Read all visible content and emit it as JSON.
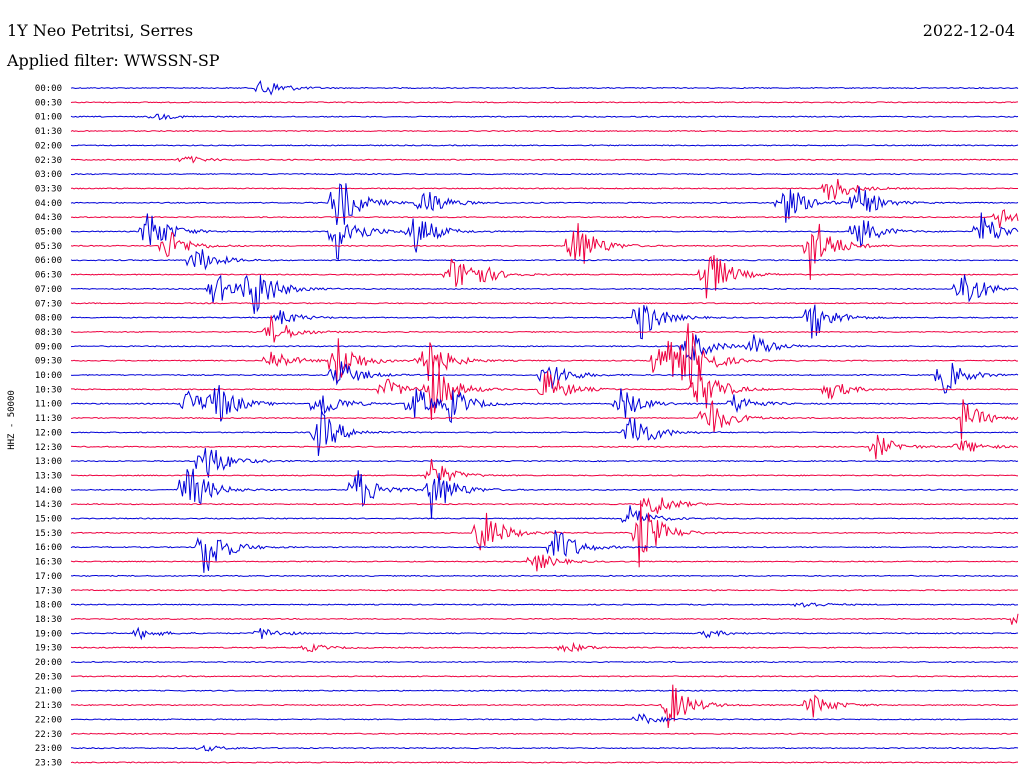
{
  "header": {
    "station": "1Y Neo Petritsi, Serres",
    "date": "2022-12-04",
    "filter": "Applied filter: WWSSN-SP"
  },
  "chart_data": {
    "type": "line",
    "ylabel": "HHZ - 50000",
    "colors": [
      "#0000d8",
      "#ee0040"
    ],
    "rows": [
      "00:00",
      "00:30",
      "01:00",
      "01:30",
      "02:00",
      "02:30",
      "03:00",
      "03:30",
      "04:00",
      "04:30",
      "05:00",
      "05:30",
      "06:00",
      "06:30",
      "07:00",
      "07:30",
      "08:00",
      "08:30",
      "09:00",
      "09:30",
      "10:00",
      "10:30",
      "11:00",
      "11:30",
      "12:00",
      "12:30",
      "13:00",
      "13:30",
      "14:00",
      "14:30",
      "15:00",
      "15:30",
      "16:00",
      "16:30",
      "17:00",
      "17:30",
      "18:00",
      "18:30",
      "19:00",
      "19:30",
      "20:00",
      "20:30",
      "21:00",
      "21:30",
      "22:00",
      "22:30",
      "23:00",
      "23:30"
    ],
    "events": [
      [
        0,
        0.2,
        0.6
      ],
      [
        2,
        0.09,
        0.15
      ],
      [
        5,
        0.12,
        0.2
      ],
      [
        8,
        0.28,
        1.6
      ],
      [
        8,
        0.37,
        0.9
      ],
      [
        8,
        0.75,
        1.2
      ],
      [
        8,
        0.83,
        0.9
      ],
      [
        7,
        0.8,
        0.8
      ],
      [
        9,
        0.98,
        0.5
      ],
      [
        10,
        0.08,
        1.3
      ],
      [
        10,
        0.28,
        1.5
      ],
      [
        10,
        0.36,
        1.2
      ],
      [
        10,
        0.83,
        0.9
      ],
      [
        10,
        0.96,
        1.0
      ],
      [
        11,
        0.1,
        0.9
      ],
      [
        11,
        0.53,
        1.6
      ],
      [
        11,
        0.78,
        1.8
      ],
      [
        12,
        0.13,
        0.8
      ],
      [
        13,
        0.4,
        0.9
      ],
      [
        13,
        0.42,
        0.7
      ],
      [
        13,
        0.67,
        1.6
      ],
      [
        14,
        0.15,
        0.9
      ],
      [
        14,
        0.19,
        1.6
      ],
      [
        14,
        0.94,
        1.2
      ],
      [
        16,
        0.22,
        0.4
      ],
      [
        16,
        0.6,
        1.2
      ],
      [
        16,
        0.78,
        1.2
      ],
      [
        17,
        0.21,
        0.8
      ],
      [
        18,
        0.65,
        1.0
      ],
      [
        18,
        0.72,
        0.6
      ],
      [
        19,
        0.21,
        0.6
      ],
      [
        19,
        0.28,
        1.3
      ],
      [
        19,
        0.37,
        1.6
      ],
      [
        19,
        0.62,
        1.8
      ],
      [
        19,
        0.65,
        1.5
      ],
      [
        20,
        0.28,
        0.9
      ],
      [
        20,
        0.5,
        1.0
      ],
      [
        20,
        0.92,
        1.0
      ],
      [
        21,
        0.33,
        0.6
      ],
      [
        21,
        0.38,
        1.5
      ],
      [
        21,
        0.5,
        1.0
      ],
      [
        21,
        0.66,
        1.6
      ],
      [
        21,
        0.8,
        0.5
      ],
      [
        22,
        0.12,
        0.8
      ],
      [
        22,
        0.15,
        1.2
      ],
      [
        22,
        0.26,
        0.9
      ],
      [
        22,
        0.36,
        1.0
      ],
      [
        22,
        0.4,
        0.8
      ],
      [
        22,
        0.58,
        0.9
      ],
      [
        22,
        0.7,
        0.5
      ],
      [
        23,
        0.67,
        1.2
      ],
      [
        23,
        0.94,
        1.0
      ],
      [
        24,
        0.26,
        1.3
      ],
      [
        24,
        0.59,
        1.3
      ],
      [
        25,
        0.85,
        0.6
      ],
      [
        25,
        0.94,
        0.4
      ],
      [
        26,
        0.14,
        1.2
      ],
      [
        27,
        0.38,
        0.8
      ],
      [
        28,
        0.12,
        1.6
      ],
      [
        28,
        0.3,
        1.2
      ],
      [
        28,
        0.38,
        1.4
      ],
      [
        29,
        0.61,
        0.8
      ],
      [
        30,
        0.59,
        0.6
      ],
      [
        31,
        0.43,
        1.5
      ],
      [
        31,
        0.6,
        1.7
      ],
      [
        32,
        0.14,
        1.6
      ],
      [
        32,
        0.51,
        1.2
      ],
      [
        33,
        0.49,
        0.5
      ],
      [
        36,
        0.77,
        0.2
      ],
      [
        37,
        1.0,
        0.9
      ],
      [
        38,
        0.07,
        0.3
      ],
      [
        38,
        0.2,
        0.3
      ],
      [
        38,
        0.67,
        0.2
      ],
      [
        39,
        0.25,
        0.2
      ],
      [
        39,
        0.52,
        0.3
      ],
      [
        43,
        0.63,
        1.3
      ],
      [
        43,
        0.78,
        0.7
      ],
      [
        44,
        0.6,
        0.3
      ],
      [
        46,
        0.14,
        0.15
      ]
    ]
  }
}
